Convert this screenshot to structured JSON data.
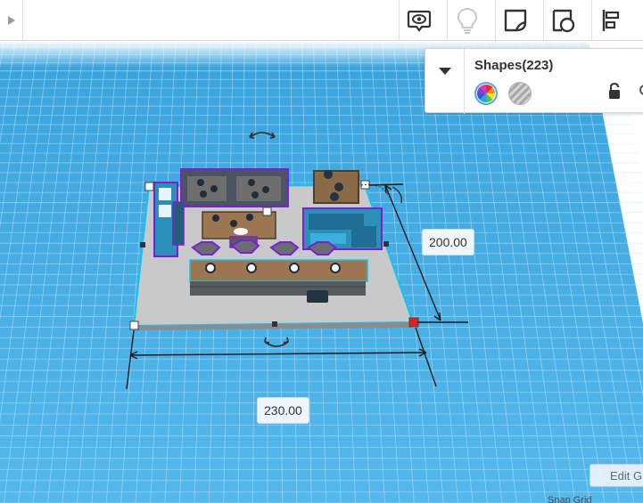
{
  "toolbar": {
    "buttons": [
      {
        "name": "view-camera-button",
        "icon": "eye-speech-icon"
      },
      {
        "name": "notes-button",
        "icon": "lightbulb-icon"
      },
      {
        "name": "note-shape-button",
        "icon": "note-shape-icon"
      },
      {
        "name": "shape-ruler-button",
        "icon": "shape-ruler-icon"
      },
      {
        "name": "align-button",
        "icon": "align-icon"
      }
    ]
  },
  "shapes_panel": {
    "title": "Shapes(223)",
    "solid_swatch": "rainbow-solid-swatch",
    "hole_swatch": "striped-hole-swatch",
    "lock_icon": "lock-icon"
  },
  "dimensions": {
    "depth_value": "200.00",
    "width_value": "230.00"
  },
  "footer": {
    "edit_grid_label": "Edit G",
    "snap_grid_label": "Snap Grid"
  },
  "colors": {
    "workplane_blue": "#39a7e2",
    "grid_line": "#c8e8f7",
    "selection_outline": "#13c4f2",
    "group_outline": "#7b1fd6",
    "corner_handle_active": "#e02020"
  }
}
